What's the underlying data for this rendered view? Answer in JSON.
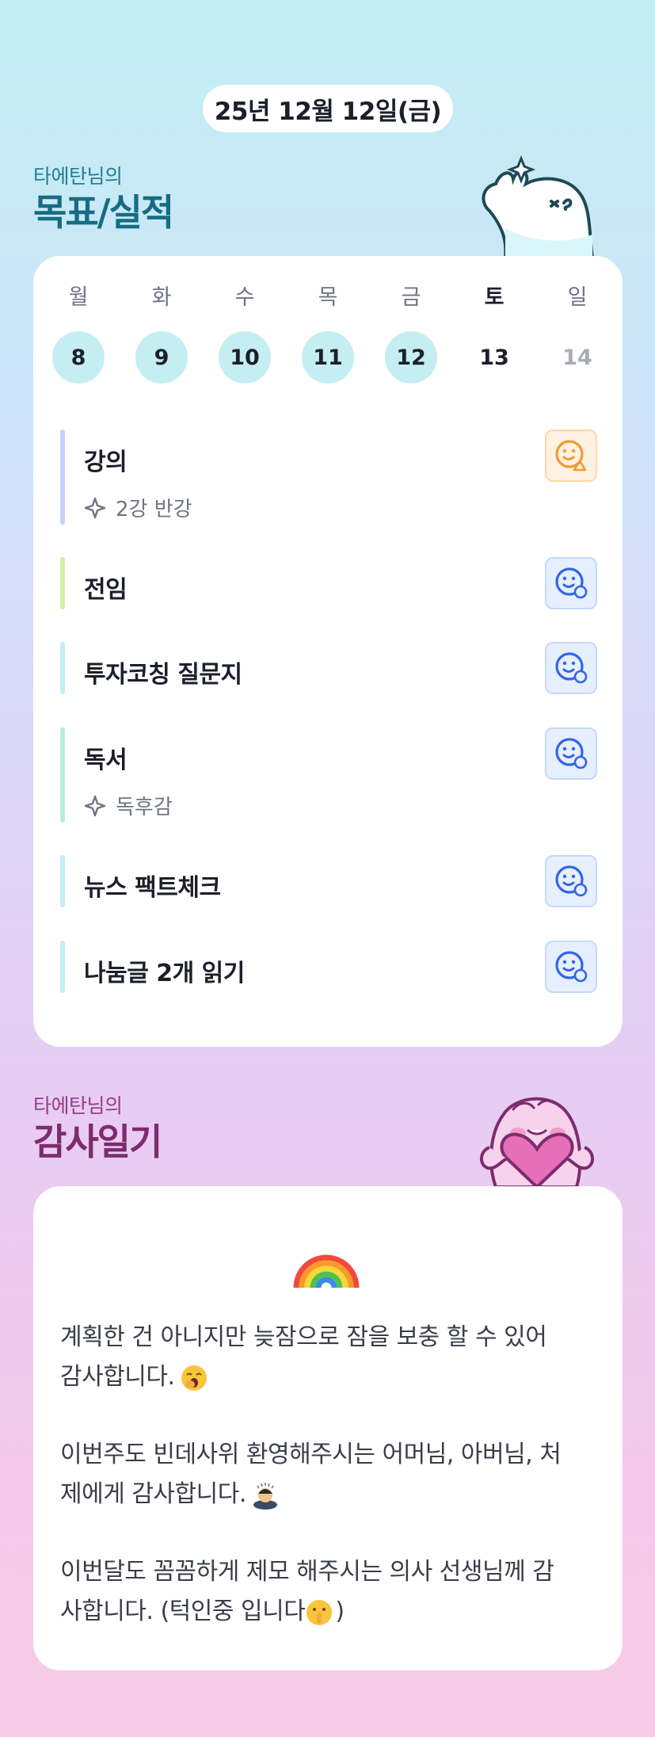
{
  "header": {
    "date": "25년 12월 12일(금)"
  },
  "goals": {
    "subtitle": "타에탄님의",
    "title": "목표/실적",
    "mascot_icon": "waving-ghost-mascot",
    "week": {
      "days": [
        {
          "name": "월",
          "num": "8",
          "state": "done"
        },
        {
          "name": "화",
          "num": "9",
          "state": "done"
        },
        {
          "name": "수",
          "num": "10",
          "state": "done"
        },
        {
          "name": "목",
          "num": "11",
          "state": "done"
        },
        {
          "name": "금",
          "num": "12",
          "state": "done"
        },
        {
          "name": "토",
          "num": "13",
          "state": "today"
        },
        {
          "name": "일",
          "num": "14",
          "state": "future"
        }
      ]
    },
    "tasks": [
      {
        "name": "강의",
        "memo": "2강 반강",
        "bar_color": "#c8d2f6",
        "status": "partial",
        "status_icon": "smile-warning-icon"
      },
      {
        "name": "전임",
        "memo": "",
        "bar_color": "#d4f0a8",
        "status": "done",
        "status_icon": "smile-check-icon"
      },
      {
        "name": "투자코칭 질문지",
        "memo": "",
        "bar_color": "#c2eef4",
        "status": "done",
        "status_icon": "smile-check-icon"
      },
      {
        "name": "독서",
        "memo": "독후감",
        "bar_color": "#b6efd8",
        "status": "done",
        "status_icon": "smile-check-icon"
      },
      {
        "name": "뉴스 팩트체크",
        "memo": "",
        "bar_color": "#c2eef4",
        "status": "done",
        "status_icon": "smile-check-icon"
      },
      {
        "name": "나눔글 2개 읽기",
        "memo": "",
        "bar_color": "#c2eef4",
        "status": "done",
        "status_icon": "smile-check-icon"
      }
    ],
    "colors": {
      "done_circle": "#c4eef2",
      "warn": "#f39a2e",
      "ok": "#3366e6"
    }
  },
  "thanks": {
    "subtitle": "타에탄님의",
    "title": "감사일기",
    "mascot_icon": "heart-hugging-mascot",
    "header_icon": "rainbow-icon",
    "entries": [
      {
        "line1": "계획한 건 아니지만 늦잠으로 잠을 보충 할 수 있어",
        "line2": "감사합니다.",
        "emoji": "yawning-face-icon"
      },
      {
        "line1": "이번주도 빈데사위 환영해주시는 어머님, 아버님, 처",
        "line2": "제에게 감사합니다.",
        "emoji": "person-bowing-icon"
      },
      {
        "line1": "이번달도 꼼꼼하게 제모 해주시는 의사 선생님께 감",
        "line2": "사합니다. (턱인중 입니다",
        "line2_suffix": ")",
        "emoji": "shushing-face-icon"
      }
    ]
  }
}
